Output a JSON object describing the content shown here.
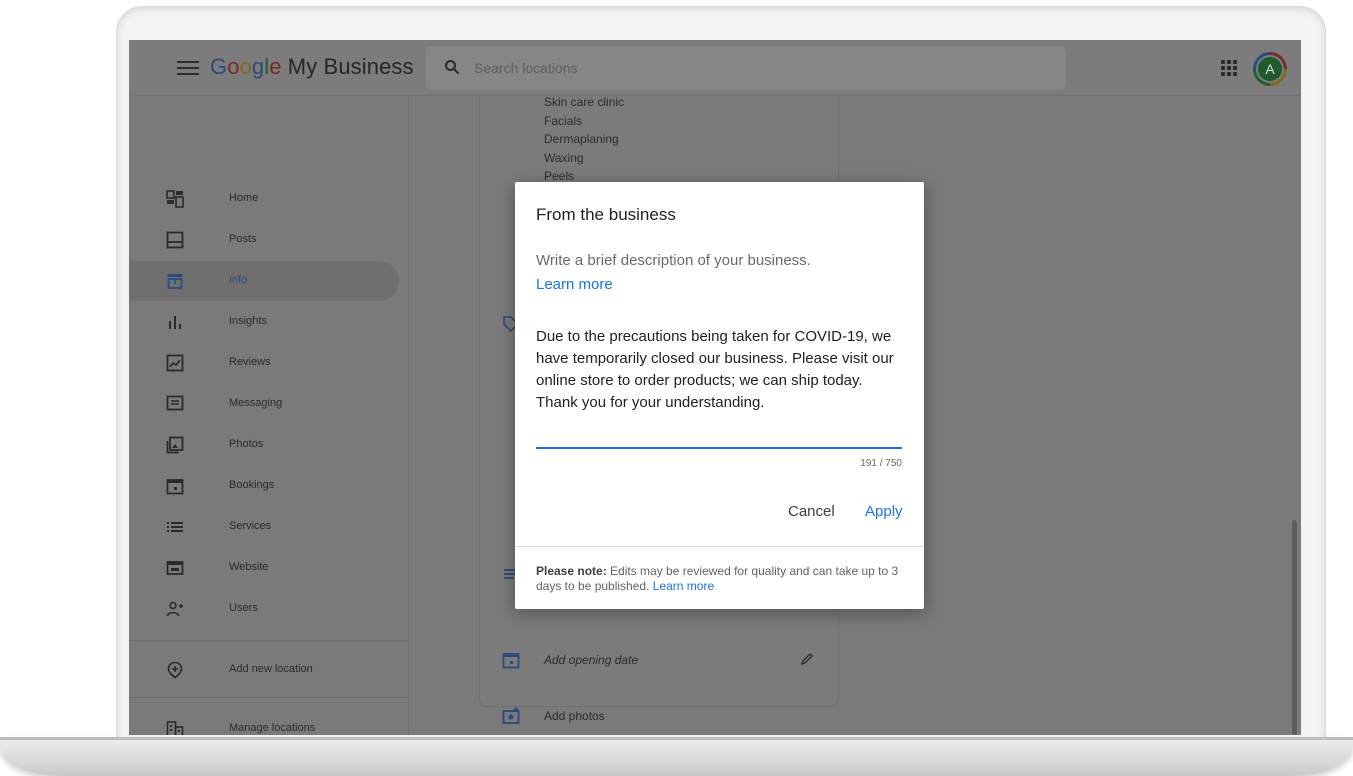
{
  "header": {
    "logo_google": "Google",
    "logo_rest": " My Business",
    "search_placeholder": "Search locations",
    "avatar_initial": "A"
  },
  "sidebar": {
    "items": [
      {
        "label": "Home",
        "icon": "dashboard-icon"
      },
      {
        "label": "Posts",
        "icon": "posts-icon"
      },
      {
        "label": "Info",
        "icon": "storefront-icon",
        "active": true
      },
      {
        "label": "Insights",
        "icon": "bar-chart-icon"
      },
      {
        "label": "Reviews",
        "icon": "reviews-icon"
      },
      {
        "label": "Messaging",
        "icon": "message-icon"
      },
      {
        "label": "Photos",
        "icon": "photos-icon"
      },
      {
        "label": "Bookings",
        "icon": "calendar-icon"
      },
      {
        "label": "Services",
        "icon": "list-icon"
      },
      {
        "label": "Website",
        "icon": "website-icon"
      },
      {
        "label": "Users",
        "icon": "add-user-icon"
      }
    ],
    "add_location": "Add new location",
    "manage_locations": "Manage locations"
  },
  "content": {
    "categories": [
      "Skin care clinic",
      "Facials",
      "Dermaplaning",
      "Waxing",
      "Peels"
    ],
    "opening_date": "Add opening date",
    "add_photos": "Add photos"
  },
  "dialog": {
    "title": "From the business",
    "description": "Write a brief description of your business.",
    "learn_more": "Learn more",
    "text": "Due to the precautions being taken for COVID-19, we have temporarily closed our business. Please visit our online store to order products; we can ship today. Thank you for your understanding.",
    "char_count": "191 / 750",
    "cancel": "Cancel",
    "apply": "Apply",
    "note_bold": "Please note:",
    "note_text": " Edits may be reviewed for quality and can take up to 3 days to be published. ",
    "note_link": "Learn more"
  },
  "colors": {
    "accent": "#1a73e8",
    "overlay": "#7a7a7a"
  }
}
